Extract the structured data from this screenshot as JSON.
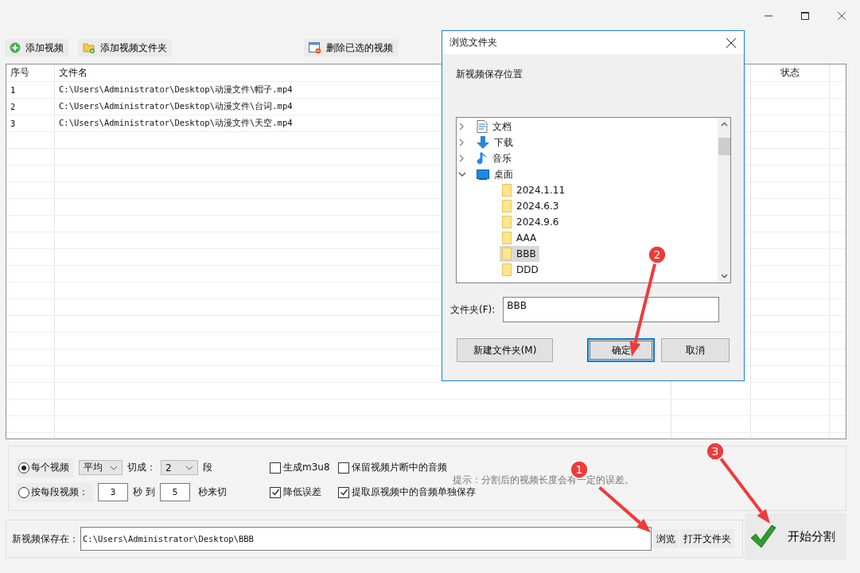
{
  "toolbar": [
    {
      "label": "添加视频",
      "kind": "add"
    },
    {
      "label": "添加视频文件夹",
      "kind": "folder-add"
    },
    {
      "label": "删除已选的视频",
      "kind": "remove"
    }
  ],
  "table": {
    "columns": [
      {
        "label": "序号"
      },
      {
        "label": "文件名"
      },
      {
        "label": "状态"
      }
    ],
    "rows": [
      {
        "index": "1",
        "file": "C:\\Users\\Administrator\\Desktop\\动漫文件\\帽子.mp4"
      },
      {
        "index": "2",
        "file": "C:\\Users\\Administrator\\Desktop\\动漫文件\\台词.mp4"
      },
      {
        "index": "3",
        "file": "C:\\Users\\Administrator\\Desktop\\动漫文件\\天空.mp4"
      }
    ]
  },
  "options": {
    "modes": [
      {
        "label": "每个视频",
        "selected": true
      },
      {
        "label": "按每段视频：",
        "selected": false
      }
    ],
    "split_method": "平均",
    "cut_label": "切成：",
    "segments": "2",
    "segments_unit": "段",
    "from_value": "3",
    "from_unit": "秒",
    "to_label": "到",
    "to_value": "5",
    "to_unit": "秒来切",
    "checkboxes": [
      {
        "label": "生成m3u8",
        "checked": false
      },
      {
        "label": "降低误差",
        "checked": true
      },
      {
        "label": "保留视频片断中的音频",
        "checked": false
      },
      {
        "label": "提取原视频中的音频单独保存",
        "checked": true
      }
    ],
    "hint": "提示：分割后的视频长度会有一定的误差。"
  },
  "save": {
    "label": "新视频保存在：",
    "value": "C:\\Users\\Administrator\\Desktop\\BBB",
    "buttons": [
      "浏览",
      "打开文件夹"
    ]
  },
  "start_button": "开始分割",
  "dialog": {
    "title": "浏览文件夹",
    "prompt": "新视频保存位置",
    "tree": [
      {
        "label": "文档",
        "kind": "document",
        "expanded": false,
        "selected": false
      },
      {
        "label": "下载",
        "kind": "download",
        "expanded": false,
        "selected": false
      },
      {
        "label": "音乐",
        "kind": "music",
        "expanded": false,
        "selected": false
      },
      {
        "label": "桌面",
        "kind": "desktop",
        "expanded": true,
        "selected": false,
        "children": [
          {
            "label": "2024.1.11",
            "kind": "folder",
            "selected": false
          },
          {
            "label": "2024.6.3",
            "kind": "folder",
            "selected": false
          },
          {
            "label": "2024.9.6",
            "kind": "folder",
            "selected": false
          },
          {
            "label": "AAA",
            "kind": "folder",
            "selected": false
          },
          {
            "label": "BBB",
            "kind": "folder",
            "selected": true
          },
          {
            "label": "DDD",
            "kind": "folder",
            "selected": false
          }
        ]
      }
    ],
    "folder_label": "文件夹(F):",
    "folder_value": "BBB",
    "buttons": [
      {
        "label": "新建文件夹(M)",
        "focused": false
      },
      {
        "label": "确定",
        "focused": true
      },
      {
        "label": "取消",
        "focused": false
      }
    ]
  },
  "annotations": [
    {
      "number": "1"
    },
    {
      "number": "2"
    },
    {
      "number": "3"
    }
  ]
}
